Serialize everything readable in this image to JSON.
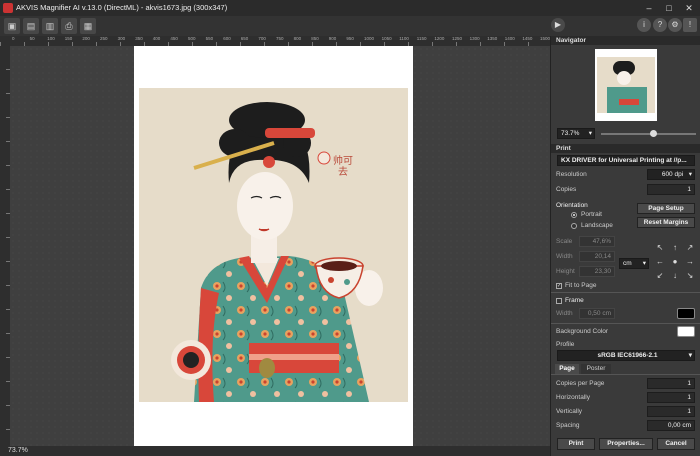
{
  "window": {
    "title": "AKVIS Magnifier AI v.13.0 (DirectML) - akvis1673.jpg (300x347)",
    "minimize": "–",
    "maximize": "□",
    "close": "✕"
  },
  "toolbar": {
    "icons": [
      "open-icon",
      "save-icon",
      "export-icon",
      "print-icon",
      "batch-icon"
    ],
    "run_icon": "▶",
    "right_icons": {
      "info": "i",
      "help": "?",
      "settings": "⚙",
      "share": "!"
    }
  },
  "ruler": {
    "ticks": [
      "0",
      "50",
      "100",
      "150",
      "200",
      "250",
      "300",
      "350",
      "400",
      "450",
      "500",
      "550",
      "600",
      "650",
      "700",
      "750",
      "800",
      "850",
      "900",
      "950",
      "1000",
      "1050",
      "1100",
      "1150",
      "1200",
      "1250",
      "1300",
      "1350",
      "1400",
      "1450",
      "1500"
    ]
  },
  "artwork": {
    "calligraphy": "帅可去"
  },
  "status": {
    "zoom": "73.7%"
  },
  "navigator": {
    "title": "Navigator",
    "zoom": "73.7%",
    "slider_fraction": 0.55
  },
  "print": {
    "title": "Print",
    "printer": "KX DRIVER for Universal Printing at //p...",
    "resolution_label": "Resolution",
    "resolution": "600 dpi",
    "copies_label": "Copies",
    "copies": "1",
    "orientation_label": "Orientation",
    "portrait": "Portrait",
    "landscape": "Landscape",
    "page_setup": "Page Setup",
    "reset_margins": "Reset Margins",
    "scale_label": "Scale",
    "scale": "47,6%",
    "width_label": "Width",
    "width": "20,14",
    "height_label": "Height",
    "height": "23,30",
    "unit": "cm",
    "fit_to_page": "Fit to Page",
    "frame": "Frame",
    "frame_width_label": "Width",
    "frame_width": "0,50 cm",
    "frame_color": "#000000",
    "background_color_label": "Background Color",
    "background_color": "#ffffff",
    "profile_label": "Profile",
    "profile": "sRGB IEC61966-2.1"
  },
  "tabs": {
    "page": "Page",
    "poster": "Poster"
  },
  "page_tab": {
    "copies_per_page_label": "Copies per Page",
    "copies_per_page": "1",
    "horizontally_label": "Horizontally",
    "horizontally": "1",
    "vertically_label": "Vertically",
    "vertically": "1",
    "spacing_label": "Spacing",
    "spacing": "0,00 cm"
  },
  "buttons": {
    "print": "Print",
    "properties": "Properties...",
    "cancel": "Cancel"
  },
  "colors": {
    "accent": "#c0392b",
    "panel": "#3a3a3a",
    "dark": "#2a2a2a"
  }
}
